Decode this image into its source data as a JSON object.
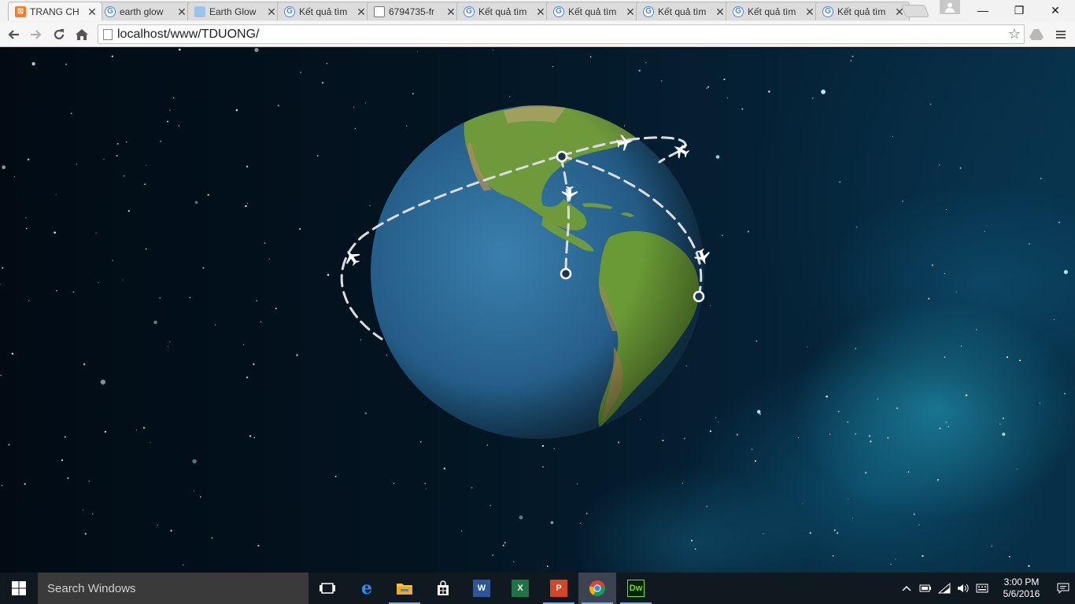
{
  "browser": {
    "tabs": [
      {
        "title": "TRANG CH",
        "favicon": "xampp-icon",
        "active": true
      },
      {
        "title": "earth glow",
        "favicon": "google-icon"
      },
      {
        "title": "Earth Glow",
        "favicon": "image-icon"
      },
      {
        "title": "Kết quả tìm",
        "favicon": "google-icon"
      },
      {
        "title": "6794735-fr",
        "favicon": "document-icon"
      },
      {
        "title": "Kết quả tìm",
        "favicon": "google-icon"
      },
      {
        "title": "Kết quả tìm",
        "favicon": "google-icon"
      },
      {
        "title": "Kết quả tìm",
        "favicon": "google-icon"
      },
      {
        "title": "Kết quả tìm",
        "favicon": "google-icon"
      },
      {
        "title": "Kết quả tìm",
        "favicon": "google-icon"
      }
    ],
    "close_glyph": "✕",
    "url": "localhost/www/TDUONG/",
    "window_controls": {
      "minimize": "—",
      "restore": "❐",
      "close": "✕"
    }
  },
  "scene": {
    "planes": 5,
    "airports": 3,
    "colors": {
      "ocean": "#2c6a96",
      "land": "#6f9a3c",
      "route": "#d9dde2",
      "nebula": "#2aa8c8"
    }
  },
  "taskbar": {
    "search_placeholder": "Search Windows",
    "apps": [
      {
        "name": "task-view-icon",
        "label": ""
      },
      {
        "name": "edge-icon",
        "label": "e"
      },
      {
        "name": "file-explorer-icon",
        "label": ""
      },
      {
        "name": "store-icon",
        "label": ""
      },
      {
        "name": "word-icon",
        "label": "W"
      },
      {
        "name": "excel-icon",
        "label": "X"
      },
      {
        "name": "powerpoint-icon",
        "label": "P"
      },
      {
        "name": "chrome-icon",
        "label": ""
      },
      {
        "name": "dreamweaver-icon",
        "label": "Dw"
      }
    ],
    "time": "3:00 PM",
    "date": "5/6/2016"
  }
}
